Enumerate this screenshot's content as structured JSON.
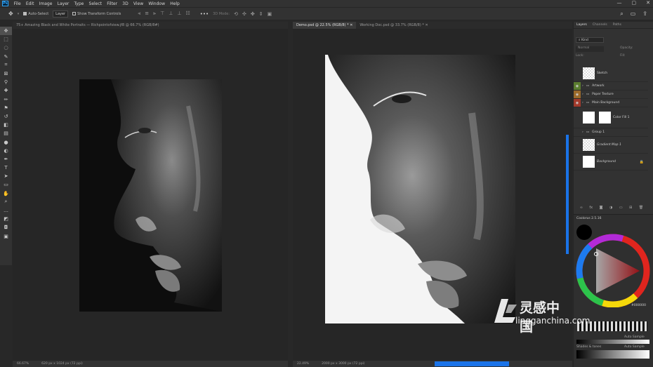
{
  "app": {
    "logo": "Ps"
  },
  "menu": [
    "File",
    "Edit",
    "Image",
    "Layer",
    "Type",
    "Select",
    "Filter",
    "3D",
    "View",
    "Window",
    "Help"
  ],
  "window_controls": {
    "minimize": "—",
    "maximize": "▢",
    "close": "✕"
  },
  "options": {
    "auto_select_label": "Auto-Select",
    "auto_select_target": "Layer",
    "show_transform_label": "Show Transform Controls",
    "mode_3d_label": "3D Mode:"
  },
  "tools": [
    "move-icon",
    "marquee-icon",
    "lasso-icon",
    "quick-select-icon",
    "crop-icon",
    "frame-icon",
    "eyedropper-icon",
    "healing-icon",
    "brush-icon",
    "stamp-icon",
    "history-brush-icon",
    "eraser-icon",
    "gradient-icon",
    "blur-icon",
    "dodge-icon",
    "pen-icon",
    "type-icon",
    "path-select-icon",
    "shape-icon",
    "hand-icon",
    "zoom-icon",
    "more-icon",
    "fg-bg-colors",
    "quick-mask-icon",
    "screen-mode-icon"
  ],
  "doc_left": {
    "tab_label": "75+ Amazing Black and White Portraits — Richpointofview.jf8 @ 66.7% (RGB/8#)",
    "zoom": "66.67%",
    "size_info": "620 px x 1024 px (72 ppi)"
  },
  "doc_right": {
    "tabs": [
      {
        "label": "Demo.psd @ 22.5% (RGB/8) *",
        "close": "✕"
      },
      {
        "label": "Working Doc.psd @ 33.7% (RGB/8) *",
        "close": "✕"
      }
    ],
    "zoom": "22.49%",
    "size_info": "2000 px x 3000 px (72 ppi)"
  },
  "layers_panel": {
    "tabs": [
      "Layers",
      "Channels",
      "Paths"
    ],
    "filter_label": "Kind",
    "blend_mode": "Normal",
    "opacity_label": "Opacity:",
    "lock_label": "Lock:",
    "fill_label": "Fill:",
    "layers": [
      {
        "name": "Sketch",
        "kind": "pixel-checker",
        "eye": false,
        "color": ""
      },
      {
        "name": "Artwork",
        "kind": "group",
        "eye": true,
        "color": "#5b7d2f"
      },
      {
        "name": "Paper Texture",
        "kind": "group",
        "eye": true,
        "color": "#9b6a2a"
      },
      {
        "name": "Main Background",
        "kind": "group",
        "eye": true,
        "color": "#a23a2c"
      },
      {
        "name": "Color Fill 1",
        "kind": "fill",
        "eye": false,
        "color": ""
      },
      {
        "name": "Group 1",
        "kind": "group",
        "eye": false,
        "color": ""
      },
      {
        "name": "Gradient Map 1",
        "kind": "pixel-checker",
        "eye": false,
        "color": ""
      },
      {
        "name": "Background",
        "kind": "background",
        "eye": false,
        "color": ""
      }
    ],
    "footer_icons": [
      "link-icon",
      "fx-icon",
      "mask-icon",
      "adjustment-icon",
      "folder-icon",
      "new-layer-icon",
      "trash-icon"
    ]
  },
  "coolorus": {
    "title": "Coolorus 2.5.16",
    "hex": "#000000",
    "auto_sample_1": "Auto Sample",
    "auto_sample_2": "Auto Sample",
    "row_label": "Shades & tones"
  },
  "watermark": {
    "brand": "灵感中国",
    "url": "lingganchina.com"
  },
  "colors": {
    "accent": "#1a73e8",
    "panel": "#323232",
    "canvas_bg": "#262626"
  }
}
